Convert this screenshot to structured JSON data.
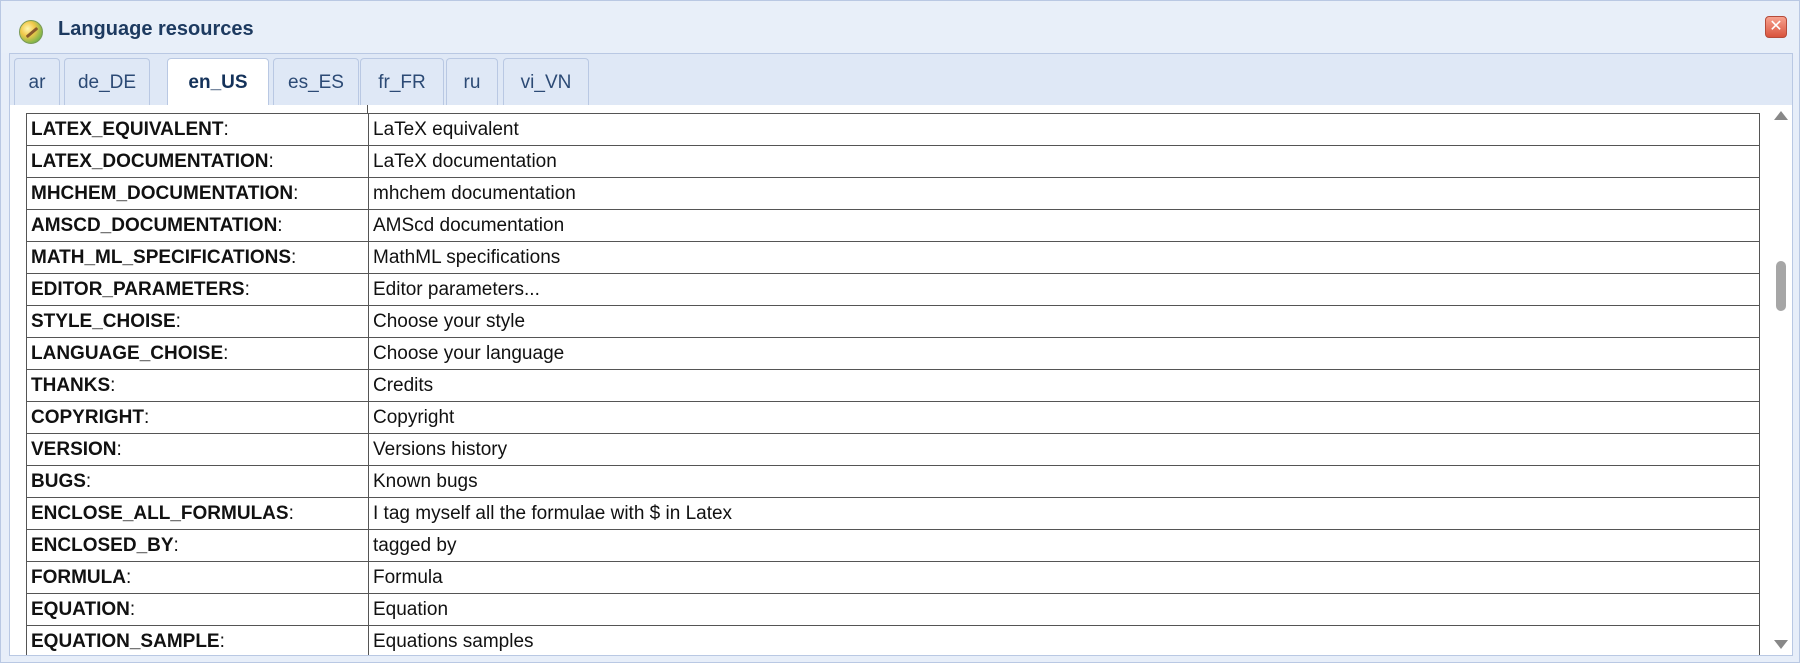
{
  "window": {
    "title": "Language resources",
    "close_label": "✕"
  },
  "tabs": [
    {
      "label": "ar",
      "active": false
    },
    {
      "label": "de_DE",
      "active": false
    },
    {
      "label": "en_US",
      "active": true
    },
    {
      "label": "es_ES",
      "active": false
    },
    {
      "label": "fr_FR",
      "active": false
    },
    {
      "label": "ru",
      "active": false
    },
    {
      "label": "vi_VN",
      "active": false
    }
  ],
  "rows": [
    {
      "key": "LATEX_EQUIVALENT",
      "sep": ":",
      "value": "LaTeX equivalent"
    },
    {
      "key": "LATEX_DOCUMENTATION",
      "sep": ":",
      "value": "LaTeX documentation"
    },
    {
      "key": "MHCHEM_DOCUMENTATION",
      "sep": ":",
      "value": "mhchem documentation"
    },
    {
      "key": "AMSCD_DOCUMENTATION",
      "sep": ":",
      "value": "AMScd documentation"
    },
    {
      "key": "MATH_ML_SPECIFICATIONS",
      "sep": ":",
      "value": "MathML specifications"
    },
    {
      "key": "EDITOR_PARAMETERS",
      "sep": ":",
      "value": "Editor parameters..."
    },
    {
      "key": "STYLE_CHOISE",
      "sep": ":",
      "value": "Choose your style"
    },
    {
      "key": "LANGUAGE_CHOISE",
      "sep": ":",
      "value": "Choose your language"
    },
    {
      "key": "THANKS",
      "sep": ":",
      "value": "Credits"
    },
    {
      "key": "COPYRIGHT",
      "sep": ":",
      "value": "Copyright"
    },
    {
      "key": "VERSION",
      "sep": ":",
      "value": "Versions history"
    },
    {
      "key": "BUGS",
      "sep": ":",
      "value": "Known bugs"
    },
    {
      "key": "ENCLOSE_ALL_FORMULAS",
      "sep": ":",
      "value": "I tag myself all the formulae with $ in Latex"
    },
    {
      "key": "ENCLOSED_BY",
      "sep": ":",
      "value": "tagged by"
    },
    {
      "key": "FORMULA",
      "sep": ":",
      "value": "Formula"
    },
    {
      "key": "EQUATION",
      "sep": ":",
      "value": "Equation"
    },
    {
      "key": "EQUATION_SAMPLE",
      "sep": ":",
      "value": "Equations samples"
    }
  ],
  "scrollbar": {
    "position_fraction": 0.3
  }
}
